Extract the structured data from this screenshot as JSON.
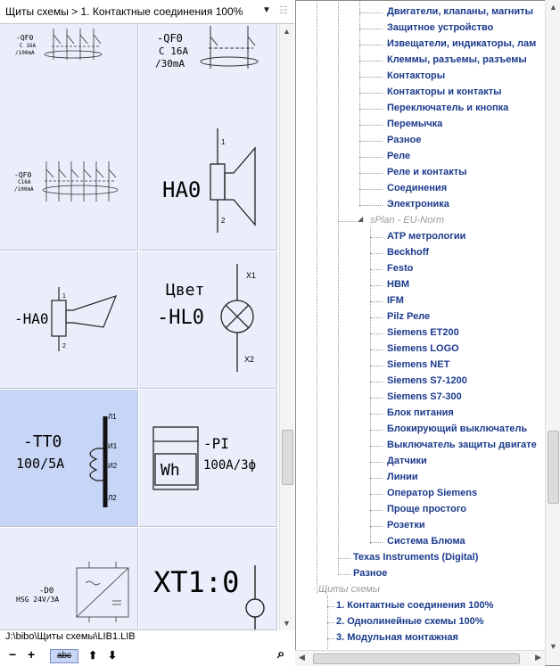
{
  "header": {
    "title": "Щиты схемы > 1. Контактные соединения 100%"
  },
  "symbols": [
    {
      "label1": "-QF0",
      "label2": "C 16A",
      "label3": "/100mA"
    },
    {
      "label1": "-QF0",
      "label2": "C 16A",
      "label3": "/30mA"
    },
    {
      "label1": "-QF0",
      "label2": "C16A",
      "label3": "/100mA"
    },
    {
      "label1": "HA0",
      "pin1": "1",
      "pin2": "2"
    },
    {
      "label1": "-HA0",
      "pin1": "1",
      "pin2": "2"
    },
    {
      "label1": "Цвет",
      "label2": "-HL0",
      "pin1": "X1",
      "pin2": "X2"
    },
    {
      "label1": "-TT0",
      "label2": "100/5A",
      "p1": "Л1",
      "p2": "И1",
      "p3": "И2",
      "p4": "Л2"
    },
    {
      "label1": "-PI",
      "label2": "100A/3ф",
      "meter": "Wh"
    },
    {
      "label1": "-D0",
      "label2": "HSG 24V/3A"
    },
    {
      "label1": "XT1:0"
    }
  ],
  "path": "J:\\bibo\\Щиты схемы\\LIB1.LIB",
  "toolbar": {
    "minus": "−",
    "plus": "+",
    "abc": "abc",
    "up": "⬆",
    "down": "⬇",
    "search": "⌕"
  },
  "tree": {
    "items_a": [
      "Двигатели, клапаны, магниты",
      "Защитное устройство",
      "Извещатели, индикаторы, лам",
      "Клеммы, разъемы, разъемы",
      "Контакторы",
      "Контакторы и контакты",
      "Переключатель и кнопка",
      "Перемычка",
      "Разное",
      "Реле",
      "Реле и контакты",
      "Соединения",
      "Электроника"
    ],
    "group_splan": "sPlan - EU-Norm",
    "items_b": [
      "ATP метрологии",
      "Beckhoff",
      "Festo",
      "HBM",
      "IFM",
      "Pilz Реле",
      "Siemens ET200",
      "Siemens LOGO",
      "Siemens NET",
      "Siemens S7-1200",
      "Siemens S7-300",
      "Блок питания",
      "Блокирующий выключатель",
      "Выключатель защиты двигате",
      "Датчики",
      "Линии",
      "Оператор Siemens",
      "Проще простого",
      "Розетки",
      "Система Блюма"
    ],
    "ti": "Texas Instruments (Digital)",
    "misc": "Разное",
    "group_shields": "Щиты схемы",
    "items_c": [
      "1. Контактные соединения 100%",
      "2. Однолинейные схемы 100%",
      "3. Модульная монтажная"
    ]
  }
}
